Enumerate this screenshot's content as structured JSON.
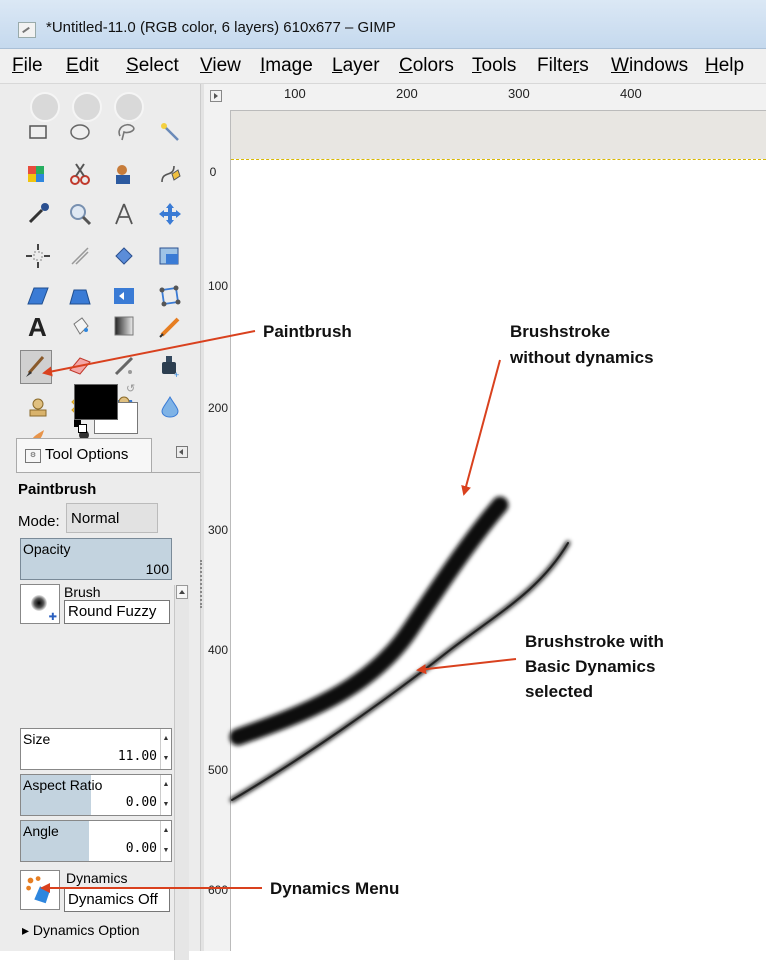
{
  "window": {
    "title": "*Untitled-11.0 (RGB color, 6 layers) 610x677 – GIMP"
  },
  "menu": [
    {
      "label": "File",
      "accel": "F",
      "rest": "ile"
    },
    {
      "label": "Edit",
      "accel": "E",
      "rest": "dit"
    },
    {
      "label": "Select",
      "accel": "S",
      "rest": "elect"
    },
    {
      "label": "View",
      "accel": "V",
      "rest": "iew"
    },
    {
      "label": "Image",
      "accel": "I",
      "rest": "mage"
    },
    {
      "label": "Layer",
      "accel": "L",
      "rest": "ayer"
    },
    {
      "label": "Colors",
      "accel": "C",
      "rest": "olors"
    },
    {
      "label": "Tools",
      "accel": "T",
      "rest": "ools"
    },
    {
      "label": "Filters",
      "pre": "Filte",
      "accel": "r",
      "rest": "s"
    },
    {
      "label": "Windows",
      "accel": "W",
      "rest": "indows"
    },
    {
      "label": "Help",
      "accel": "H",
      "rest": "elp"
    }
  ],
  "ruler": {
    "horizontal_labels": [
      "100",
      "200",
      "300",
      "400"
    ],
    "vertical_labels": [
      "0",
      "100",
      "200",
      "300",
      "400",
      "500",
      "600"
    ]
  },
  "tool_options": {
    "tab_label": "Tool Options",
    "tool_name": "Paintbrush",
    "mode_label": "Mode:",
    "mode_value": "Normal",
    "opacity_label": "Opacity",
    "opacity_value": "100",
    "opacity_fraction": 1.0,
    "brush_label": "Brush",
    "brush_value": "Round Fuzzy",
    "size_label": "Size",
    "size_value": "11.00",
    "aspect_label": "Aspect Ratio",
    "aspect_value": "0.00",
    "angle_label": "Angle",
    "angle_value": "0.00",
    "dynamics_label": "Dynamics",
    "dynamics_value": "Dynamics Off",
    "dynamics_options_label": "Dynamics Option"
  },
  "annotations": {
    "paintbrush": "Paintbrush",
    "no_dynamics_line1": "Brushstroke",
    "no_dynamics_line2": "without dynamics",
    "with_dynamics_line1": "Brushstroke with",
    "with_dynamics_line2": "Basic Dynamics",
    "with_dynamics_line3": "selected",
    "dynamics_menu": "Dynamics Menu"
  },
  "colors": {
    "annotation_arrow": "#d9411e",
    "foreground": "#000000",
    "background": "#ffffff",
    "slider_fill": "#c3d3df"
  },
  "icons": [
    "rect-select-icon",
    "ellipse-select-icon",
    "free-select-icon",
    "fuzzy-select-icon",
    "color-select-icon",
    "scissors-select-icon",
    "foreground-select-icon",
    "paths-icon",
    "color-picker-icon",
    "zoom-icon",
    "measure-icon",
    "move-icon",
    "align-icon",
    "crop-icon",
    "rotate-icon",
    "scale-icon",
    "shear-icon",
    "perspective-icon",
    "flip-icon",
    "cage-transform-icon",
    "text-icon",
    "bucket-fill-icon",
    "blend-icon",
    "pencil-icon",
    "paintbrush-icon",
    "eraser-icon",
    "airbrush-icon",
    "ink-icon",
    "clone-icon",
    "heal-icon",
    "perspective-clone-icon",
    "blur-icon",
    "smudge-icon",
    "dodge-burn-icon"
  ]
}
